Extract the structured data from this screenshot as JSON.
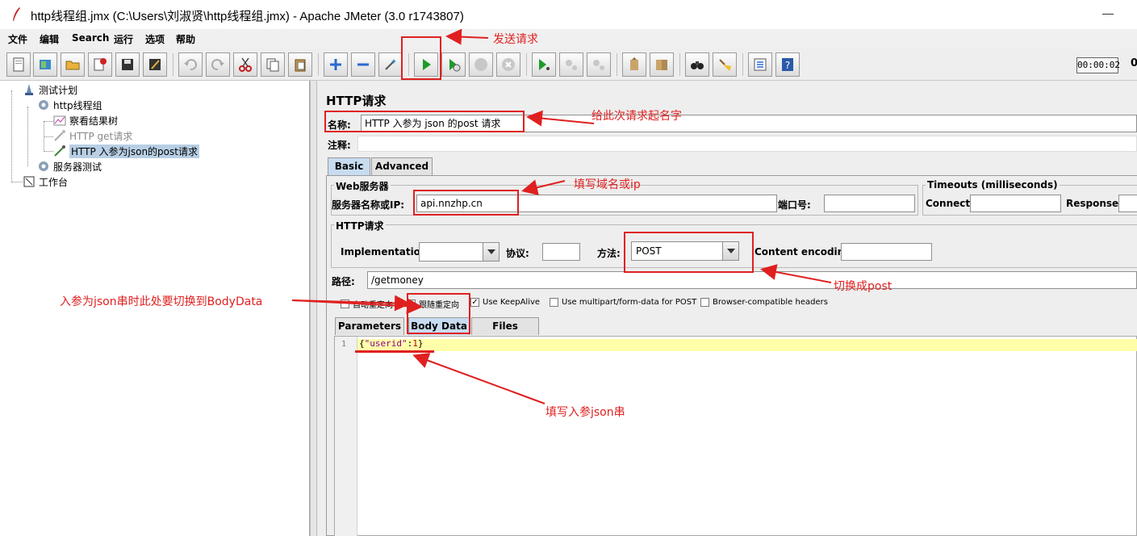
{
  "window": {
    "title": "http线程组.jmx (C:\\Users\\刘淑贤\\http线程组.jmx) - Apache JMeter (3.0 r1743807)"
  },
  "menu": [
    "文件",
    "编辑",
    "Search",
    "运行",
    "选项",
    "帮助"
  ],
  "toolbar": {
    "timer": "00:00:02",
    "trailing_value": "0"
  },
  "tree": {
    "items": [
      {
        "label": "测试计划",
        "icon": "test-plan-icon"
      },
      {
        "label": "http线程组",
        "icon": "gear-icon"
      },
      {
        "label": "察看结果树",
        "icon": "chart-icon"
      },
      {
        "label": "HTTP  get请求",
        "icon": "pipette-icon"
      },
      {
        "label": "HTTP 入参为json的post请求",
        "icon": "pipette-icon"
      },
      {
        "label": "服务器测试",
        "icon": "gear-icon"
      },
      {
        "label": "工作台",
        "icon": "workbench-icon"
      }
    ]
  },
  "form": {
    "panel_title": "HTTP请求",
    "name_label": "名称:",
    "name_value": "HTTP 入参为 json 的post 请求",
    "comment_label": "注释:",
    "tabs": [
      "Basic",
      "Advanced"
    ],
    "web_server_group": "Web服务器",
    "server_label": "服务器名称或IP:",
    "server_value": "api.nnzhp.cn",
    "port_label": "端口号:",
    "timeouts_group": "Timeouts (milliseconds)",
    "connect_label": "Connect:",
    "response_label": "Response:",
    "http_request_group": "HTTP请求",
    "implementation_label": "Implementation:",
    "protocol_label": "协议:",
    "method_label": "方法:",
    "method_value": "POST",
    "content_encoding_label": "Content encoding:",
    "path_label": "路径:",
    "path_value": "/getmoney",
    "checkboxes": [
      {
        "label": "自动重定向",
        "checked": false
      },
      {
        "label": "跟随重定向",
        "checked": true
      },
      {
        "label": "Use KeepAlive",
        "checked": true
      },
      {
        "label": "Use multipart/form-data for POST",
        "checked": false
      },
      {
        "label": "Browser-compatible headers",
        "checked": false
      }
    ],
    "subtabs": [
      "Parameters",
      "Body Data",
      "Files Upload"
    ],
    "active_subtab": "Body Data",
    "body_line_number": "1",
    "body_open": "{",
    "body_key": "\"userid\"",
    "body_colon": ":",
    "body_value": "1",
    "body_close": "}"
  },
  "annotations": {
    "send_request": "发送请求",
    "name_request": "给此次请求起名字",
    "fill_domain": "填写域名或ip",
    "switch_post": "切换成post",
    "switch_bodydata": "入参为json串时此处要切换到BodyData",
    "fill_json": "填写入参json串"
  },
  "colors": {
    "annotation_red": "#e02020",
    "selected_tab": "#c8dcf0",
    "selected_tree_item": "#b8cfe5",
    "current_line": "#ffffaa"
  }
}
